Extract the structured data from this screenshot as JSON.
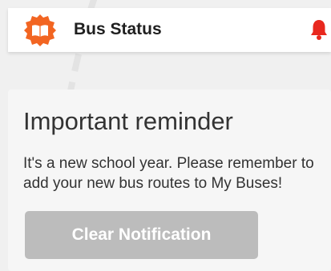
{
  "header": {
    "title": "Bus Status",
    "logo_icon": "open-book-badge-icon",
    "notification_icon": "bell-icon",
    "brand_color": "#f26522",
    "alert_color": "#e8281e"
  },
  "notification": {
    "title": "Important reminder",
    "message": "It's a new school year. Please remember to add your new bus routes to My Buses!",
    "clear_button_label": "Clear Notification",
    "button_state": "disabled",
    "button_color": "#bcbcbc"
  }
}
